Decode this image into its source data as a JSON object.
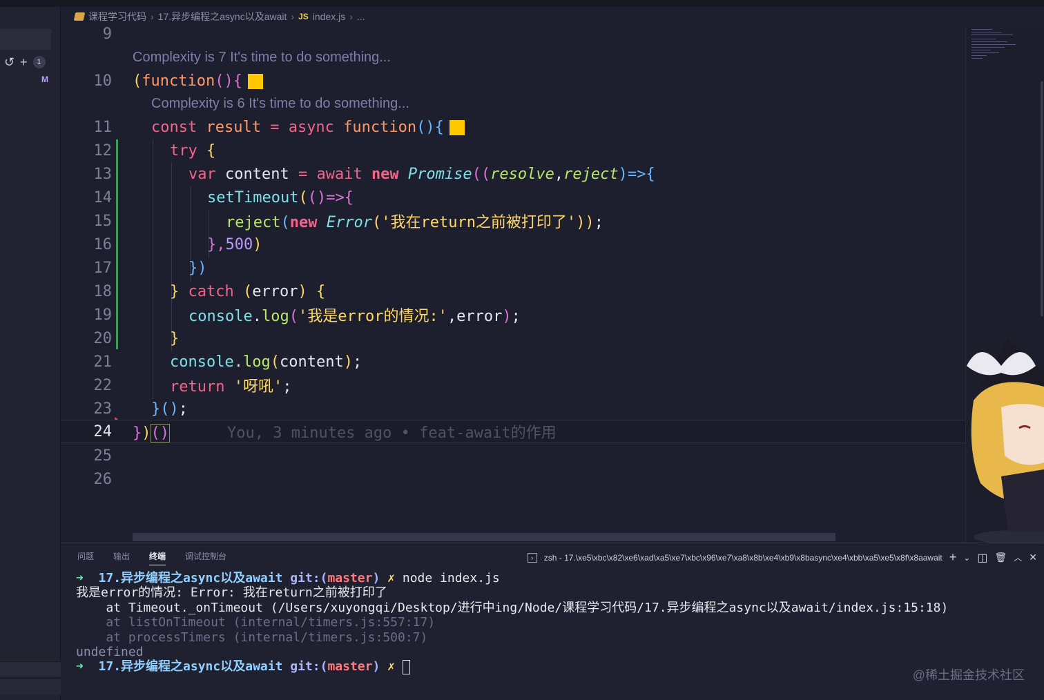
{
  "breadcrumb": {
    "items": [
      "课程学习代码",
      "17.异步编程之async以及await",
      "index.js",
      "..."
    ],
    "file_badge": "JS"
  },
  "scm": {
    "badge_count": "1",
    "modified_mark": "M"
  },
  "editor": {
    "codelens_1": "Complexity is 7 It's time to do something...",
    "codelens_2": "Complexity is 6 It's time to do something...",
    "line_numbers": [
      "9",
      "10",
      "11",
      "12",
      "13",
      "14",
      "15",
      "16",
      "17",
      "18",
      "19",
      "20",
      "21",
      "22",
      "23",
      "24",
      "25",
      "26"
    ],
    "lines": {
      "l10": {
        "a": "(",
        "b": "function",
        "c": "(){"
      },
      "l11": {
        "a": "const",
        "b": " result ",
        "c": "=",
        "d": " async ",
        "e": "function",
        "f": "(){"
      },
      "l12": {
        "a": "try",
        "b": " {"
      },
      "l13": {
        "a": "var",
        "b": " content ",
        "c": "=",
        "d": " await ",
        "e": "new",
        "f": " Promise",
        "g": "((",
        "h": "resolve",
        "i": ",",
        "j": "reject",
        "k": ")=>{"
      },
      "l14": {
        "a": "setTimeout",
        "b": "(",
        "c": "()=>{"
      },
      "l15": {
        "a": "reject",
        "b": "(",
        "c": "new",
        "d": " Error",
        "e": "(",
        "f": "'我在return之前被打印了'",
        "g": "))",
        "h": ";"
      },
      "l16": {
        "a": "},",
        "b": "500",
        "c": ")"
      },
      "l17": {
        "a": "})"
      },
      "l18": {
        "a": "}",
        "b": " catch ",
        "c": "(",
        "d": "error",
        "e": ")",
        "f": " {"
      },
      "l19": {
        "a": "console",
        "b": ".",
        "c": "log",
        "d": "(",
        "e": "'我是error的情况:'",
        "f": ",error",
        "g": ")",
        "h": ";"
      },
      "l20": {
        "a": "}"
      },
      "l21": {
        "a": "console",
        "b": ".",
        "c": "log",
        "d": "(",
        "e": "content",
        "f": ")",
        "g": ";"
      },
      "l22": {
        "a": "return",
        "b": " '呀吼'",
        "c": ";"
      },
      "l23": {
        "a": "}",
        "b": "()",
        "c": ";"
      },
      "l24": {
        "a": "}",
        "b": ")",
        "c": "()",
        "blame": "You, 3 minutes ago • feat-await的作用"
      }
    }
  },
  "panel": {
    "tabs": [
      "问题",
      "输出",
      "终端",
      "调试控制台"
    ],
    "active_tab": "终端",
    "terminal_title": "zsh - 17.\\xe5\\xbc\\x82\\xe6\\xad\\xa5\\xe7\\xbc\\x96\\xe7\\xa8\\x8b\\xe4\\xb9\\x8basync\\xe4\\xbb\\xa5\\xe5\\x8f\\x8aawait"
  },
  "terminal": {
    "prompt_arrow": "➜",
    "dir": "17.异步编程之async以及await",
    "git_label": "git:(",
    "branch": "master",
    "git_close": ")",
    "dirty": "✗",
    "command": "node index.js",
    "out1": "我是error的情况: Error: 我在return之前被打印了",
    "out2": "    at Timeout._onTimeout (/Users/xuyongqi/Desktop/进行中ing/Node/课程学习代码/17.异步编程之async以及await/index.js:15:18)",
    "out3": "    at listOnTimeout (internal/timers.js:557:17)",
    "out4": "    at processTimers (internal/timers.js:500:7)",
    "out5": "undefined"
  },
  "watermark": "@稀土掘金技术社区"
}
